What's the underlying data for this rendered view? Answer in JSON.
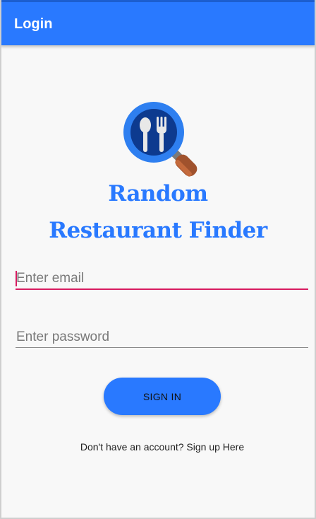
{
  "app_bar": {
    "title": "Login"
  },
  "logo": {
    "icon": "restaurant-search-icon",
    "colors": {
      "ring": "#1e6fe0",
      "disc": "#0d3a8f",
      "utensils": "#e8e8e8",
      "handle": "#a0522d"
    }
  },
  "app_name": {
    "line1": "Random",
    "line2": "Restaurant Finder"
  },
  "form": {
    "email": {
      "placeholder": "Enter email",
      "value": ""
    },
    "password": {
      "placeholder": "Enter password",
      "value": ""
    },
    "sign_in_label": "SIGN IN",
    "signup_text": "Don't have an account? Sign up Here"
  },
  "colors": {
    "primary": "#2979ff",
    "accent": "#d81b60",
    "background": "#f8f8f8"
  }
}
